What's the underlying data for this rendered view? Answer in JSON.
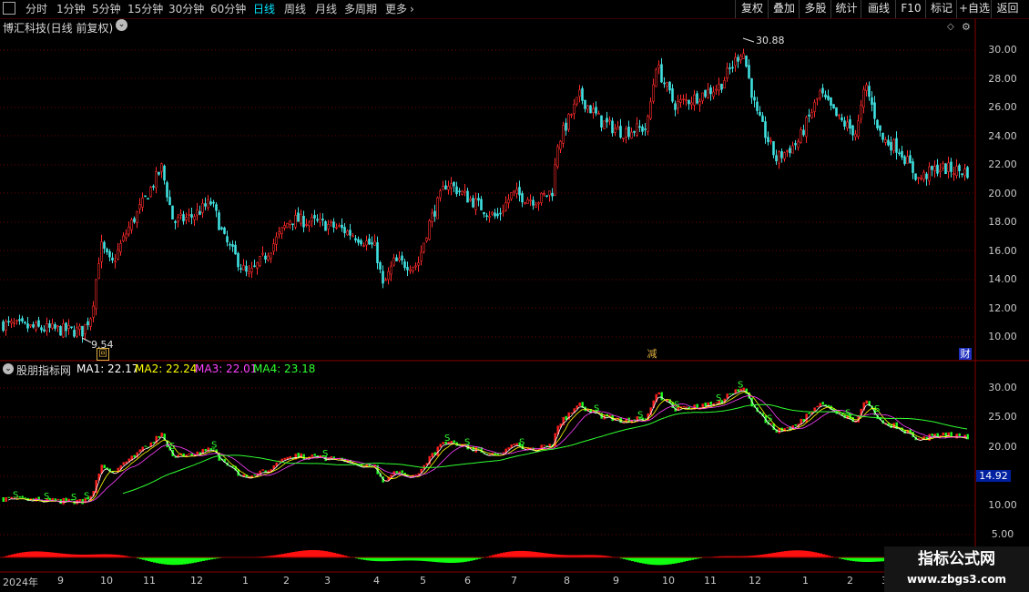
{
  "toolbar": {
    "periods": [
      "分时",
      "1分钟",
      "5分钟",
      "15分钟",
      "30分钟",
      "60分钟",
      "日线",
      "周线",
      "月线",
      "多周期",
      "更多"
    ],
    "active_period": "日线",
    "right_buttons": [
      "复权",
      "叠加",
      "多股",
      "统计",
      "画线",
      "F10",
      "标记",
      "+自选",
      "返回"
    ]
  },
  "price_panel": {
    "title": "博汇科技(日线 前复权)",
    "y_ticks": [
      "30.00",
      "28.00",
      "26.00",
      "24.00",
      "22.00",
      "20.00",
      "18.00",
      "16.00",
      "14.00",
      "12.00",
      "10.00"
    ],
    "high_label": "30.88",
    "low_label": "9.54",
    "badges": [
      {
        "text": "回",
        "color": "#e0b040"
      },
      {
        "text": "减",
        "color": "#e0b040"
      },
      {
        "text": "财",
        "color": "#4060ff"
      }
    ]
  },
  "indicator_panel": {
    "name": "股朋指标网",
    "ma_values": [
      {
        "label": "MA1: 22.17",
        "color": "#ffffff"
      },
      {
        "label": "MA2: 22.24",
        "color": "#ffff00"
      },
      {
        "label": "MA3: 22.01",
        "color": "#ff40ff"
      },
      {
        "label": "MA4: 23.18",
        "color": "#30ff30"
      }
    ],
    "y_ticks": [
      "30.00",
      "25.00",
      "20.00",
      "15.00",
      "10.00",
      "5.00"
    ],
    "current_value": "14.92"
  },
  "time_axis": {
    "labels": [
      "2024年",
      "9",
      "10",
      "11",
      "12",
      "1",
      "2",
      "3",
      "4",
      "5",
      "6",
      "7",
      "8",
      "9",
      "10",
      "11",
      "12",
      "1",
      "2",
      "3"
    ]
  },
  "watermark": {
    "title": "指标公式网",
    "url": "www.zbgs3.com"
  },
  "colors": {
    "up": "#ff2a2a",
    "down": "#40e0e0",
    "ma4": "#30ff30",
    "grid": "#5a0000"
  }
}
